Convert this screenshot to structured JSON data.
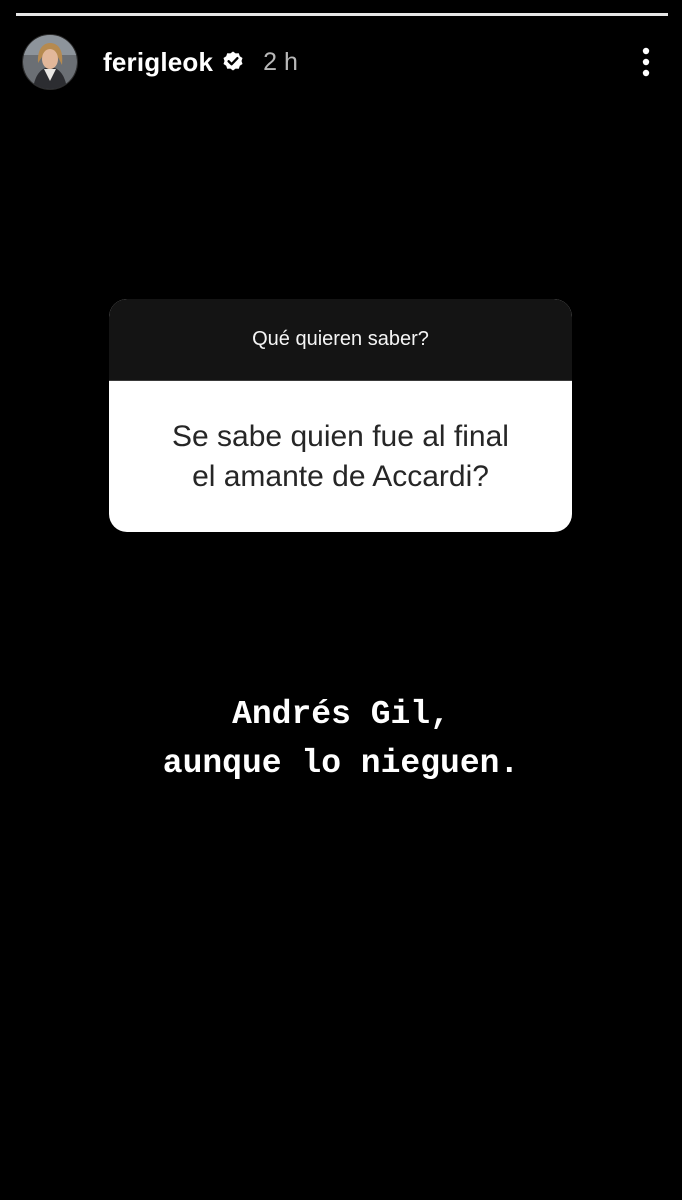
{
  "story": {
    "progress_segments": 1
  },
  "header": {
    "username": "ferigleok",
    "timestamp": "2 h",
    "verified_icon": "verified-badge-icon",
    "more_icon": "more-vertical-icon"
  },
  "question_sticker": {
    "prompt": "Qué quieren saber?",
    "question_line1": "Se sabe quien fue al final",
    "question_line2": "el amante de Accardi?"
  },
  "answer": {
    "line1": "Andrés Gil,",
    "line2": "aunque lo nieguen."
  },
  "colors": {
    "background": "#000000",
    "card_prompt_bg": "#141414",
    "card_body_bg": "#ffffff",
    "question_text": "#262626"
  }
}
